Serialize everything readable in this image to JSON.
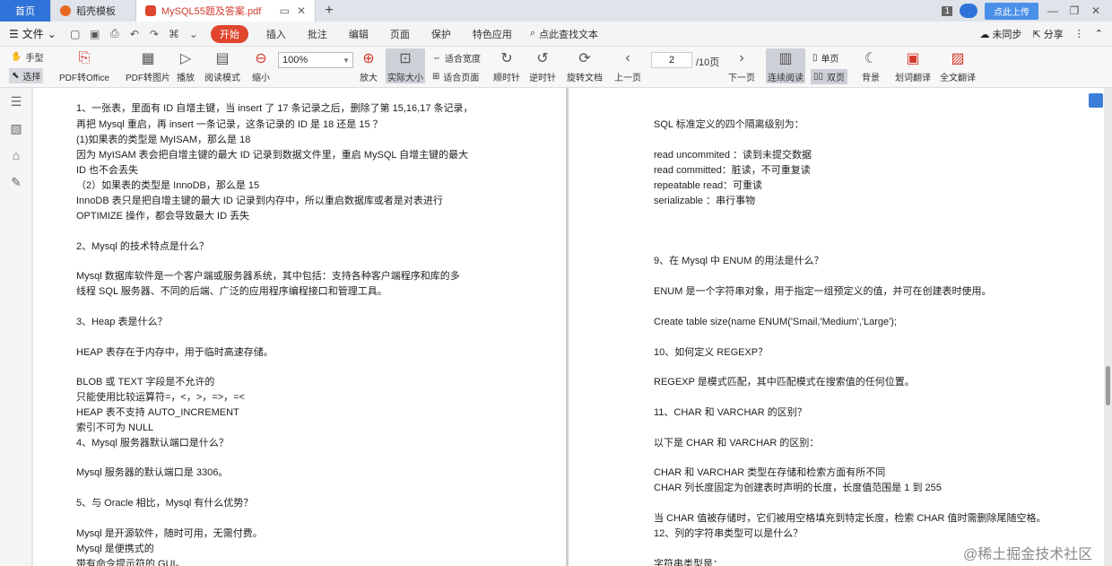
{
  "titlebar": {
    "home_tab": "首页",
    "template_tab": "稻壳模板",
    "doc_tab": "MySQL55题及答案.pdf",
    "window_count": "1",
    "upload_label": "点此上传"
  },
  "menubar": {
    "file_label": "文件",
    "start_label": "开始",
    "items": [
      "插入",
      "批注",
      "编辑",
      "页面",
      "保护",
      "特色应用"
    ],
    "search_label": "点此查找文本",
    "sync_label": "未同步",
    "share_label": "分享"
  },
  "toolbar": {
    "hand_label": "手型",
    "select_label": "选择",
    "pdf_to_office": "PDF转Office",
    "pdf_to_image": "PDF转图片",
    "play": "播放",
    "read_mode": "阅读模式",
    "zoom_out": "缩小",
    "zoom_value": "100%",
    "zoom_in": "放大",
    "actual_size": "实际大小",
    "fit_width": "适合宽度",
    "fit_page": "适合页面",
    "rotate_cw": "顺时针",
    "rotate_ccw": "逆时针",
    "rotate_doc": "旋转文档",
    "prev_page": "上一页",
    "page_current": "2",
    "page_total": "/10页",
    "next_page": "下一页",
    "continuous": "连续阅读",
    "single_page": "单页",
    "double_page": "双页",
    "background": "背景",
    "word_translate": "划词翻译",
    "full_translate": "全文翻译"
  },
  "left_page": [
    "1、一张表，里面有 ID 自增主键，当 insert 了 17 条记录之后，删除了第 15,16,17 条记录，",
    "再把 Mysql 重启，再 insert 一条记录，这条记录的 ID 是 18 还是 15 ？",
    "(1)如果表的类型是 MyISAM，那么是 18",
    "因为 MyISAM 表会把自增主键的最大 ID 记录到数据文件里，重启 MySQL 自增主键的最大",
    "ID 也不会丢失",
    "（2）如果表的类型是 InnoDB，那么是 15",
    "InnoDB 表只是把自增主键的最大 ID 记录到内存中，所以重启数据库或者是对表进行",
    "OPTIMIZE 操作，都会导致最大 ID 丢失",
    "2、Mysql 的技术特点是什么？",
    "Mysql 数据库软件是一个客户端或服务器系统，其中包括：支持各种客户端程序和库的多",
    "线程 SQL 服务器、不同的后端、广泛的应用程序编程接口和管理工具。",
    "3、Heap 表是什么？",
    "HEAP 表存在于内存中，用于临时高速存储。",
    "BLOB 或 TEXT 字段是不允许的",
    "只能使用比较运算符=，<，>，=>，=<",
    "HEAP 表不支持 AUTO_INCREMENT",
    "索引不可为 NULL",
    "4、Mysql 服务器默认端口是什么？",
    "Mysql 服务器的默认端口是 3306。",
    "5、与 Oracle 相比，Mysql 有什么优势？",
    "Mysql 是开源软件，随时可用，无需付费。",
    "Mysql 是便携式的",
    "带有命令提示符的 GUI。"
  ],
  "right_page": [
    "SQL 标准定义的四个隔离级别为：",
    "read uncommited ：读到未提交数据",
    "read committed：脏读，不可重复读",
    "repeatable read：可重读",
    "serializable ：串行事物",
    "9、在 Mysql 中 ENUM 的用法是什么？",
    "ENUM 是一个字符串对象，用于指定一组预定义的值，并可在创建表时使用。",
    "Create table size(name ENUM('Smail,'Medium','Large');",
    "10、如何定义 REGEXP？",
    "REGEXP 是模式匹配，其中匹配模式在搜索值的任何位置。",
    "11、CHAR 和 VARCHAR 的区别？",
    "以下是 CHAR 和 VARCHAR 的区别：",
    "CHAR 和 VARCHAR 类型在存储和检索方面有所不同",
    "CHAR 列长度固定为创建表时声明的长度，长度值范围是 1 到 255",
    "当 CHAR 值被存储时，它们被用空格填充到特定长度，检索 CHAR 值时需删除尾随空格。",
    "12、列的字符串类型可以是什么？",
    "字符串类型是："
  ],
  "watermark": "@稀土掘金技术社区"
}
